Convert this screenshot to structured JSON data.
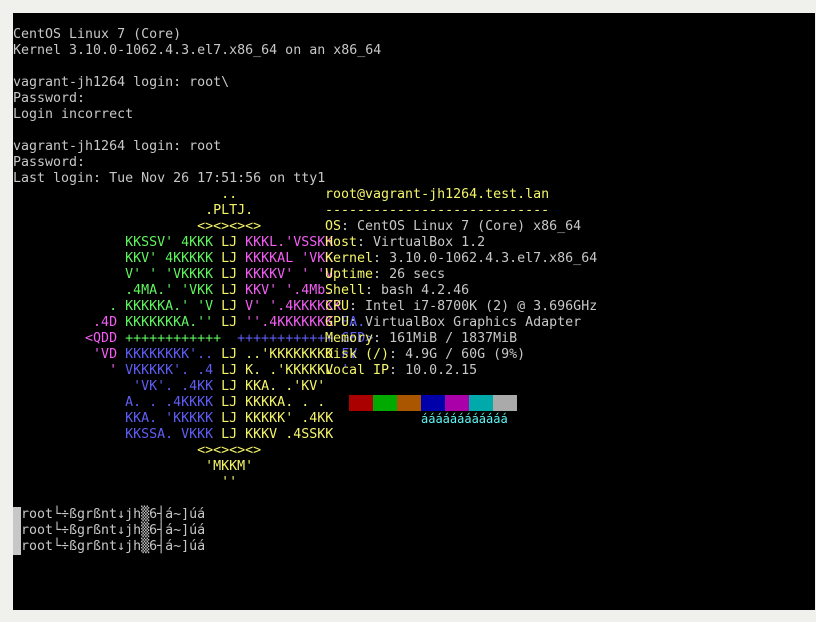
{
  "console": {
    "boot": [
      "CentOS Linux 7 (Core)",
      "Kernel 3.10.0-1062.4.3.el7.x86_64 on an x86_64",
      "vagrant-jh1264 login: root\\",
      "Password:",
      "Login incorrect",
      "vagrant-jh1264 login: root",
      "Password:",
      "Last login: Tue Nov 26 17:51:56 on tty1"
    ],
    "ascii_logo": [
      [
        {
          "t": "                          ..",
          "c": "y"
        }
      ],
      [
        {
          "t": "                        .PLTJ.",
          "c": "y"
        }
      ],
      [
        {
          "t": "                       <><><><>",
          "c": "y"
        }
      ],
      [
        {
          "t": "              KKSSV' 4KKK ",
          "c": "g"
        },
        {
          "t": "LJ",
          "c": "y"
        },
        {
          "t": " KKKL.'VSSKK",
          "c": "m"
        }
      ],
      [
        {
          "t": "              KKV' 4KKKKK ",
          "c": "g"
        },
        {
          "t": "LJ",
          "c": "y"
        },
        {
          "t": " KKKKAL 'VKK",
          "c": "m"
        }
      ],
      [
        {
          "t": "              V' ' 'VKKKK ",
          "c": "g"
        },
        {
          "t": "LJ",
          "c": "y"
        },
        {
          "t": " KKKKV' ' 'V",
          "c": "m"
        }
      ],
      [
        {
          "t": "              .4MA.' 'VKK ",
          "c": "g"
        },
        {
          "t": "LJ",
          "c": "y"
        },
        {
          "t": " KKV' '.4Mb.",
          "c": "m"
        }
      ],
      [
        {
          "t": "            . KKKKKA.' 'V ",
          "c": "g"
        },
        {
          "t": "LJ",
          "c": "y"
        },
        {
          "t": " V' '.4KKKKKK ",
          "c": "m"
        },
        {
          "t": ".",
          "c": "b"
        }
      ],
      [
        {
          "t": "          .4D ",
          "c": "m"
        },
        {
          "t": "KKKKKKKA.'' ",
          "c": "g"
        },
        {
          "t": "LJ",
          "c": "y"
        },
        {
          "t": " ''.4KKKKKKK ",
          "c": "m"
        },
        {
          "t": "FA.",
          "c": "b"
        }
      ],
      [
        {
          "t": "         <QDD ",
          "c": "m"
        },
        {
          "t": "++++++++++++  ",
          "c": "g"
        },
        {
          "t": "++++++++++++ ",
          "c": "b"
        },
        {
          "t": "GFD>",
          "c": "b"
        }
      ],
      [
        {
          "t": "          'VD ",
          "c": "m"
        },
        {
          "t": "KKKKKKKK'.. ",
          "c": "b"
        },
        {
          "t": "LJ",
          "c": "y"
        },
        {
          "t": " ..'KKKKKKKK ",
          "c": "y"
        },
        {
          "t": "FV",
          "c": "b"
        }
      ],
      [
        {
          "t": "            ' ",
          "c": "m"
        },
        {
          "t": "VKKKKK'. .4 ",
          "c": "b"
        },
        {
          "t": "LJ",
          "c": "y"
        },
        {
          "t": " K. .'KKKKKV ",
          "c": "y"
        },
        {
          "t": "'",
          "c": "b"
        }
      ],
      [
        {
          "t": "               'VK'. .4KK ",
          "c": "b"
        },
        {
          "t": "LJ",
          "c": "y"
        },
        {
          "t": " KKA. .'KV'",
          "c": "y"
        }
      ],
      [
        {
          "t": "              A. . .4KKKK ",
          "c": "b"
        },
        {
          "t": "LJ",
          "c": "y"
        },
        {
          "t": " KKKKA. . .4",
          "c": "y"
        }
      ],
      [
        {
          "t": "              KKA. 'KKKKK ",
          "c": "b"
        },
        {
          "t": "LJ",
          "c": "y"
        },
        {
          "t": " KKKKK' .4KK",
          "c": "y"
        }
      ],
      [
        {
          "t": "              KKSSA. VKKK ",
          "c": "b"
        },
        {
          "t": "LJ",
          "c": "y"
        },
        {
          "t": " KKKV .4SSKK",
          "c": "y"
        }
      ],
      [
        {
          "t": "                       <><><><>",
          "c": "y"
        }
      ],
      [
        {
          "t": "                        'MKKM'",
          "c": "y"
        }
      ],
      [
        {
          "t": "                          ''",
          "c": "y"
        }
      ]
    ],
    "info": {
      "header": "root@vagrant-jh1264.test.lan",
      "separator": "----------------------------",
      "rows": [
        {
          "key": "OS",
          "value": "CentOS Linux 7 (Core) x86_64"
        },
        {
          "key": "Host",
          "value": "VirtualBox 1.2"
        },
        {
          "key": "Kernel",
          "value": "3.10.0-1062.4.3.el7.x86_64"
        },
        {
          "key": "Uptime",
          "value": "26 secs"
        },
        {
          "key": "Shell",
          "value": "bash 4.2.46"
        },
        {
          "key": "CPU",
          "value": "Intel i7-8700K (2) @ 3.696GHz"
        },
        {
          "key": "GPU",
          "value": "VirtualBox Graphics Adapter"
        },
        {
          "key": "Memory",
          "value": "161MiB / 1837MiB"
        },
        {
          "key": "Disk (/)",
          "value": "4.9G / 60G (9%)"
        },
        {
          "key": "Local IP",
          "value": "10.0.2.15"
        }
      ],
      "palette": [
        "#000000",
        "#aa0000",
        "#00aa00",
        "#aa5500",
        "#0000aa",
        "#aa00aa",
        "#00aaaa",
        "#aaaaaa"
      ],
      "palette_text": "áááááááááááá"
    },
    "garbled_prompts": [
      "root└÷ßgrßnt↓jh▒6┤á~]úá",
      "root└÷ßgrßnt↓jh▒6┤á~]úá",
      "root└÷ßgrßnt↓jh▒6┤á~]úá"
    ]
  },
  "colors": {
    "background": "#000000",
    "text": "#c7c7c7",
    "yellow": "#f5f56a",
    "green": "#5ef55e",
    "blue": "#5e5ef5",
    "magenta": "#f55ef5",
    "cyan": "#5ef5f5",
    "window_border": "#f0f0ed"
  }
}
